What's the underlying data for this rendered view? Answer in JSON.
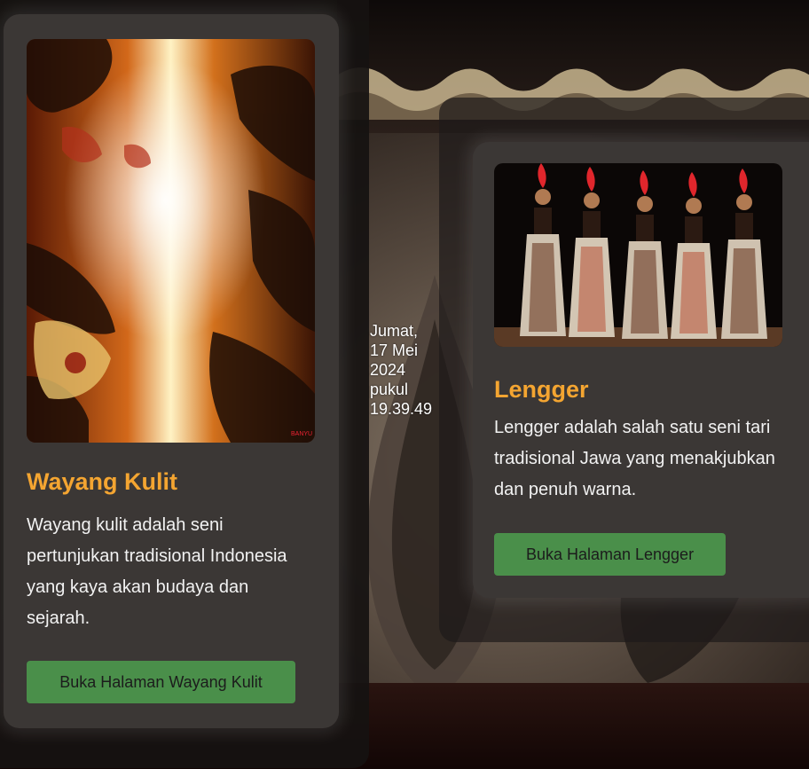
{
  "date_display": {
    "line1": "Jumat,",
    "line2": "17 Mei",
    "line3": "2024",
    "line4": "pukul",
    "line5": "19.39.49"
  },
  "cards": [
    {
      "title": "Wayang Kulit",
      "description": "Wayang kulit adalah seni pertunjukan tradisional Indonesia yang kaya akan budaya dan sejarah.",
      "button_label": "Buka Halaman Wayang Kulit",
      "image_icon": "wayang-kulit-image"
    },
    {
      "title": "Lengger",
      "description": "Lengger adalah salah satu seni tari tradisional Jawa yang menakjubkan dan penuh warna.",
      "button_label": "Buka Halaman Lengger",
      "image_icon": "lengger-dancers-image"
    }
  ],
  "colors": {
    "title_accent": "#f4a531",
    "button": "#4a8f4a",
    "card_bg": "#3b3735"
  }
}
